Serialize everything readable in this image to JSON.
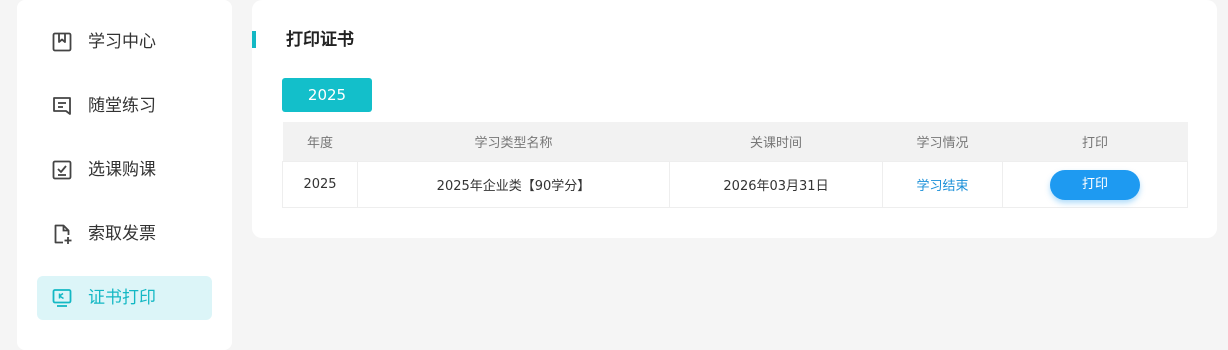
{
  "sidebar": {
    "items": [
      {
        "label": "学习中心",
        "icon": "bookmark-icon",
        "active": false
      },
      {
        "label": "随堂练习",
        "icon": "message-icon",
        "active": false
      },
      {
        "label": "选课购课",
        "icon": "checkbox-icon",
        "active": false
      },
      {
        "label": "索取发票",
        "icon": "file-add-icon",
        "active": false
      },
      {
        "label": "证书打印",
        "icon": "monitor-icon",
        "active": true
      }
    ]
  },
  "main": {
    "title": "打印证书",
    "year_tab": "2025",
    "table": {
      "headers": [
        "年度",
        "学习类型名称",
        "关课时间",
        "学习情况",
        "打印"
      ],
      "rows": [
        {
          "year": "2025",
          "type_name": "2025年企业类【90学分】",
          "close_time": "2026年03月31日",
          "status": "学习结束",
          "action": "打印"
        }
      ]
    }
  },
  "colors": {
    "accent": "#13b8c4",
    "active_bg": "#dcf5f8",
    "link": "#1a8fd8",
    "button": "#1e9af1"
  }
}
